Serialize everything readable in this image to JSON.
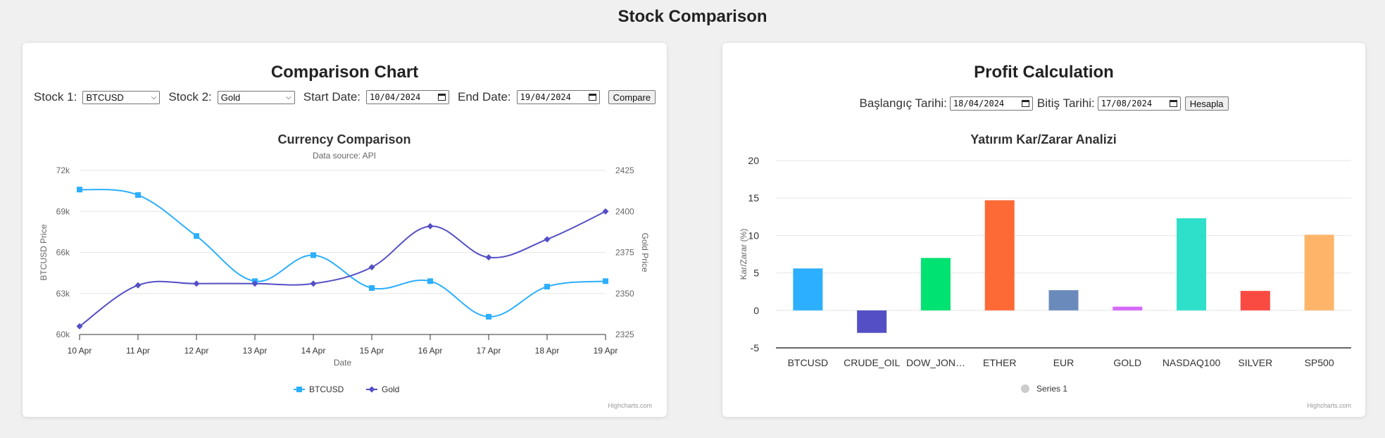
{
  "page": {
    "title": "Stock Comparison"
  },
  "left_panel": {
    "title": "Comparison Chart",
    "stock1_label": "Stock 1:",
    "stock1_value": "BTCUSD",
    "stock2_label": "Stock 2:",
    "stock2_value": "Gold",
    "start_label": "Start Date:",
    "start_value": "10/04/2024",
    "end_label": "End Date:",
    "end_value": "19/04/2024",
    "compare_label": "Compare",
    "credit": "Highcharts.com"
  },
  "right_panel": {
    "title": "Profit Calculation",
    "start_label": "Başlangıç Tarihi:",
    "start_value": "18/04/2024",
    "end_label": "Bitiş Tarihi:",
    "end_value": "17/08/2024",
    "calc_label": "Hesapla",
    "credit": "Highcharts.com"
  },
  "chart_data": [
    {
      "type": "line",
      "title": "Currency Comparison",
      "subtitle": "Data source: API",
      "xlabel": "Date",
      "categories": [
        "10 Apr",
        "11 Apr",
        "12 Apr",
        "13 Apr",
        "14 Apr",
        "15 Apr",
        "16 Apr",
        "17 Apr",
        "18 Apr",
        "19 Apr"
      ],
      "y_left": {
        "label": "BTCUSD Price",
        "lim": [
          60000,
          72000
        ],
        "ticks": [
          "60k",
          "63k",
          "66k",
          "69k",
          "72k"
        ]
      },
      "y_right": {
        "label": "Gold Price",
        "lim": [
          2325,
          2425
        ],
        "ticks": [
          "2325",
          "2350",
          "2375",
          "2400",
          "2425"
        ]
      },
      "series": [
        {
          "name": "BTCUSD",
          "axis": "left",
          "color": "#2caffe",
          "marker": "square",
          "values": [
            70600,
            70200,
            67200,
            63900,
            65800,
            63400,
            63900,
            61300,
            63500,
            63900
          ]
        },
        {
          "name": "Gold",
          "axis": "right",
          "color": "#544fc5",
          "marker": "diamond",
          "values": [
            2330,
            2355,
            2356,
            2356,
            2356,
            2366,
            2391,
            2372,
            2383,
            2400
          ]
        }
      ],
      "legend": "bottom-center",
      "grid": true
    },
    {
      "type": "bar",
      "title": "Yatırım Kar/Zarar Analizi",
      "ylabel": "Kar/Zarar (%)",
      "ylim": [
        -5,
        20
      ],
      "yticks": [
        "-5",
        "0",
        "5",
        "10",
        "15",
        "20"
      ],
      "categories": [
        "BTCUSD",
        "CRUDE_OIL",
        "DOW_JON…",
        "ETHER",
        "EUR",
        "GOLD",
        "NASDAQ100",
        "SILVER",
        "SP500"
      ],
      "series": [
        {
          "name": "Series 1",
          "values": [
            5.6,
            -3.0,
            7.0,
            14.7,
            2.7,
            0.5,
            12.3,
            2.6,
            10.1
          ]
        }
      ],
      "colors": [
        "#2caffe",
        "#544fc5",
        "#00e272",
        "#fe6a35",
        "#6b8abc",
        "#d568fb",
        "#2ee0ca",
        "#fa4b42",
        "#feb56a"
      ],
      "legend": "bottom-center",
      "grid": true
    }
  ]
}
